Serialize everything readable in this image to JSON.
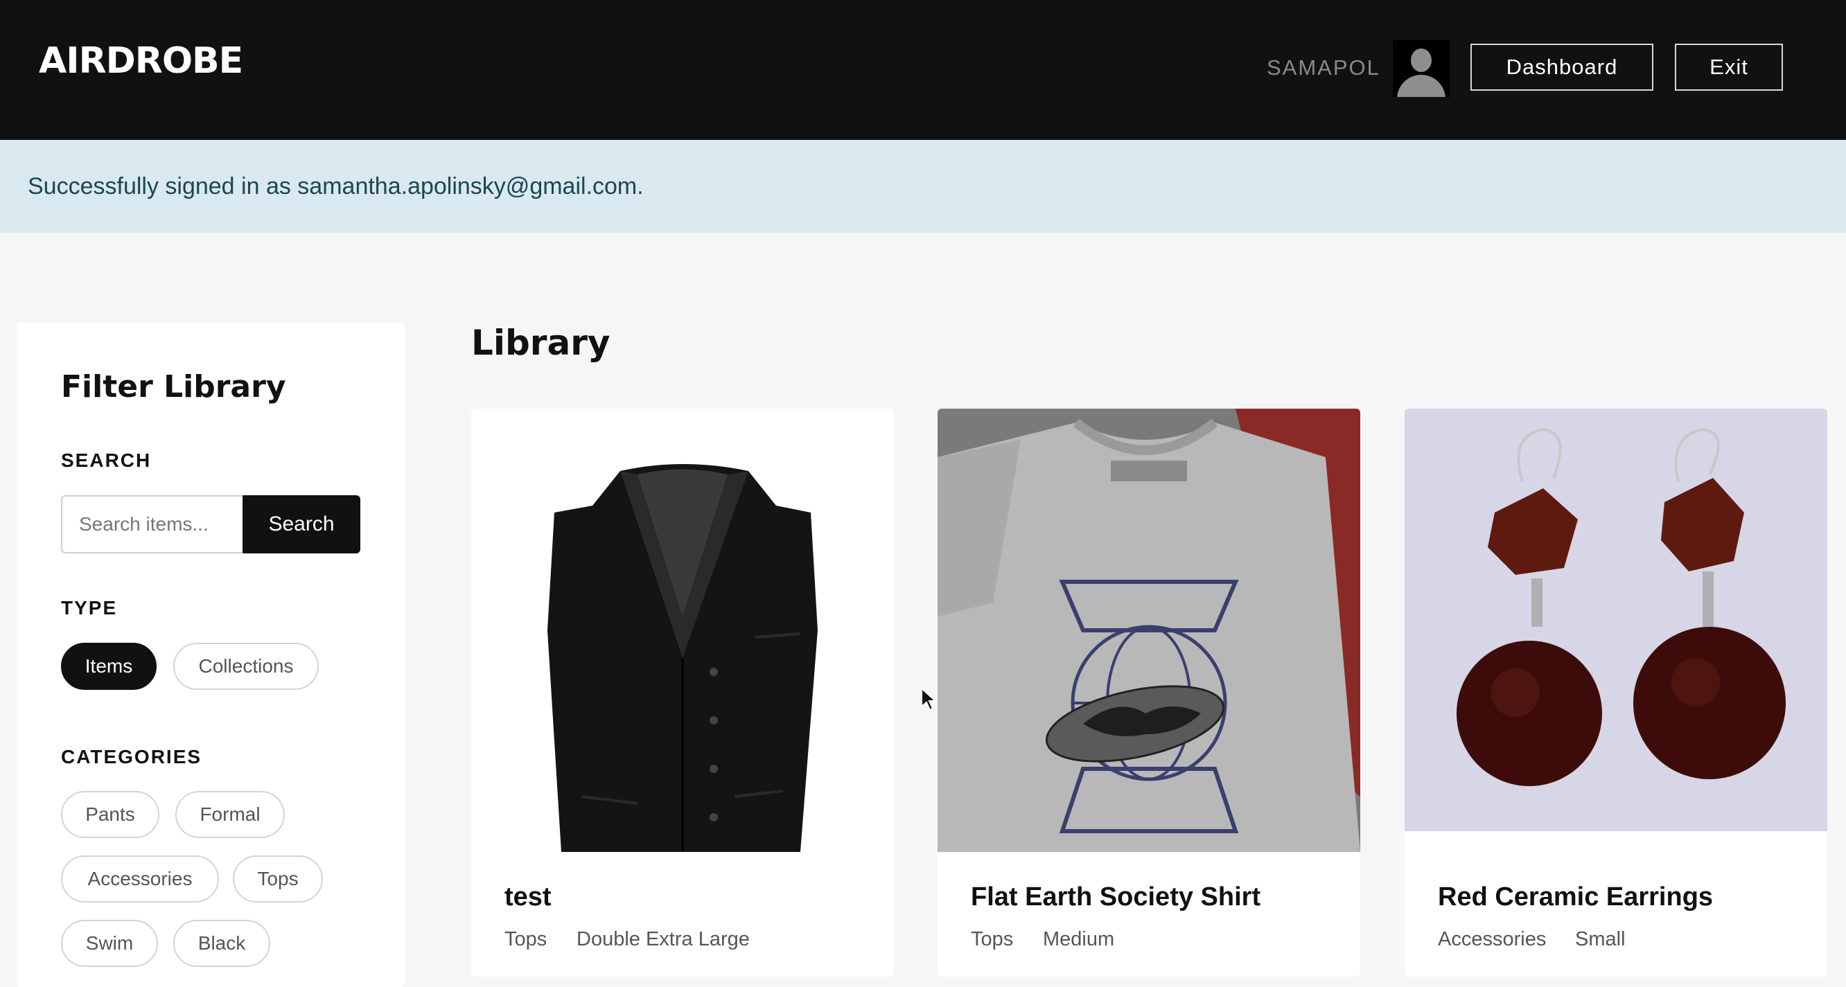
{
  "header": {
    "logo": "AIRDROBE",
    "username": "SAMAPOL",
    "dashboard_label": "Dashboard",
    "exit_label": "Exit"
  },
  "flash": {
    "message": "Successfully signed in as samantha.apolinsky@gmail.com."
  },
  "sidebar": {
    "title": "Filter Library",
    "search_label": "SEARCH",
    "search_placeholder": "Search items...",
    "search_button": "Search",
    "type_label": "TYPE",
    "types": [
      {
        "label": "Items",
        "active": true
      },
      {
        "label": "Collections",
        "active": false
      }
    ],
    "categories_label": "CATEGORIES",
    "categories": [
      "Pants",
      "Formal",
      "Accessories",
      "Tops",
      "Swim",
      "Black"
    ]
  },
  "main": {
    "title": "Library",
    "items": [
      {
        "title": "test",
        "category": "Tops",
        "size": "Double Extra Large",
        "image": "black-vest"
      },
      {
        "title": "Flat Earth Society Shirt",
        "category": "Tops",
        "size": "Medium",
        "image": "grey-tshirt"
      },
      {
        "title": "Red Ceramic Earrings",
        "category": "Accessories",
        "size": "Small",
        "image": "red-earrings"
      }
    ]
  },
  "colors": {
    "header_bg": "#111111",
    "flash_bg": "#d9e9ef",
    "flash_text": "#1c4653",
    "page_bg": "#f5f6f5"
  }
}
